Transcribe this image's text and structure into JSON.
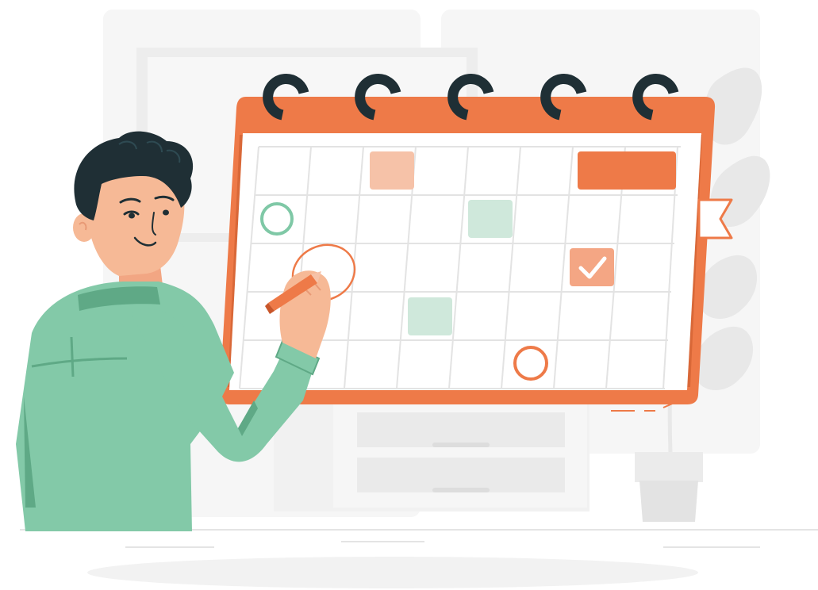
{
  "illustration": {
    "subject": "man-marking-calendar",
    "colors": {
      "calendar_frame": "#EE7A48",
      "calendar_paper": "#FFFFFF",
      "grid_line": "#E3E3E3",
      "ring": "#1F2F35",
      "peach_cell": "#F6C2A8",
      "mint_cell": "#CFE8DB",
      "mint_circle": "#7FC8A6",
      "shirt": "#83C9A8",
      "shirt_shadow": "#5FA986",
      "skin": "#F6B996",
      "hair": "#1F2F35",
      "background_shape": "#EFEFEF",
      "floor_shadow": "#F2F2F2"
    },
    "icons": [
      "check-icon",
      "pencil-icon",
      "calendar-ring-icon",
      "bookmark-tab-icon"
    ]
  }
}
